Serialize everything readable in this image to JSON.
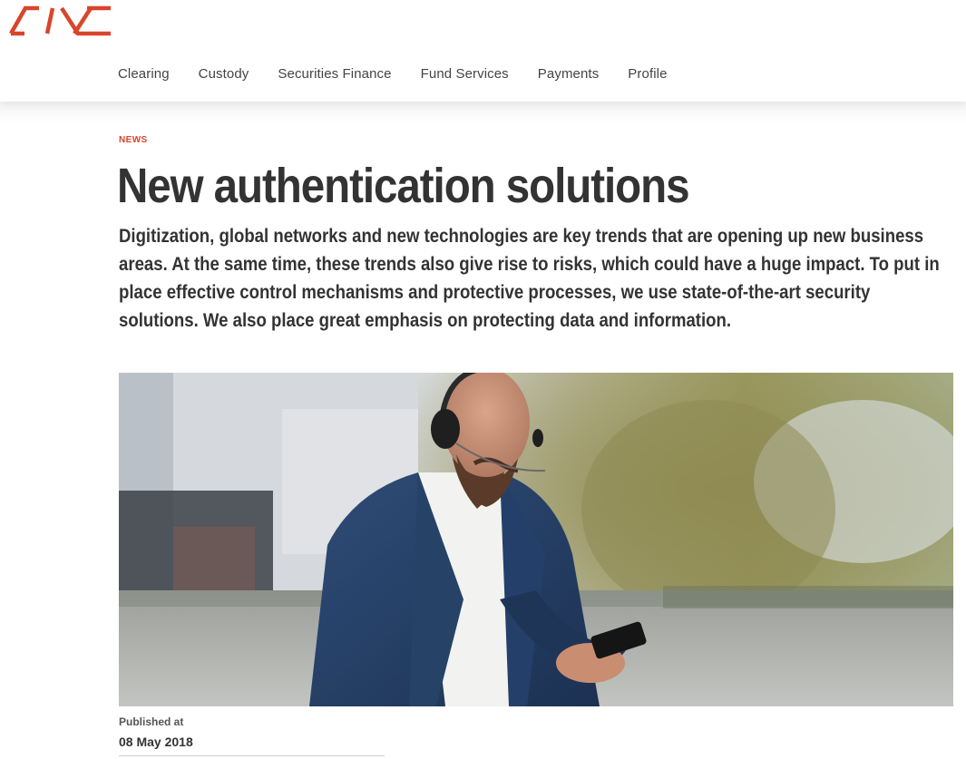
{
  "brand": {
    "logo_text": "SIX",
    "accent_color": "#d9452b"
  },
  "nav": {
    "items": [
      {
        "label": "Clearing"
      },
      {
        "label": "Custody"
      },
      {
        "label": "Securities Finance"
      },
      {
        "label": "Fund Services"
      },
      {
        "label": "Payments"
      },
      {
        "label": "Profile"
      }
    ]
  },
  "article": {
    "category": "NEWS",
    "title": "New authentication solutions",
    "lead": "Digitization, global networks and new technologies are key trends that are opening up new business areas. At the same time, these trends also give rise to risks, which could have a huge impact. To put in place effective control mechanisms and protective processes, we use state-of-the-art security solutions. We also place great emphasis on protecting data and information.",
    "published_label": "Published at",
    "published_date": "08 May 2018"
  }
}
